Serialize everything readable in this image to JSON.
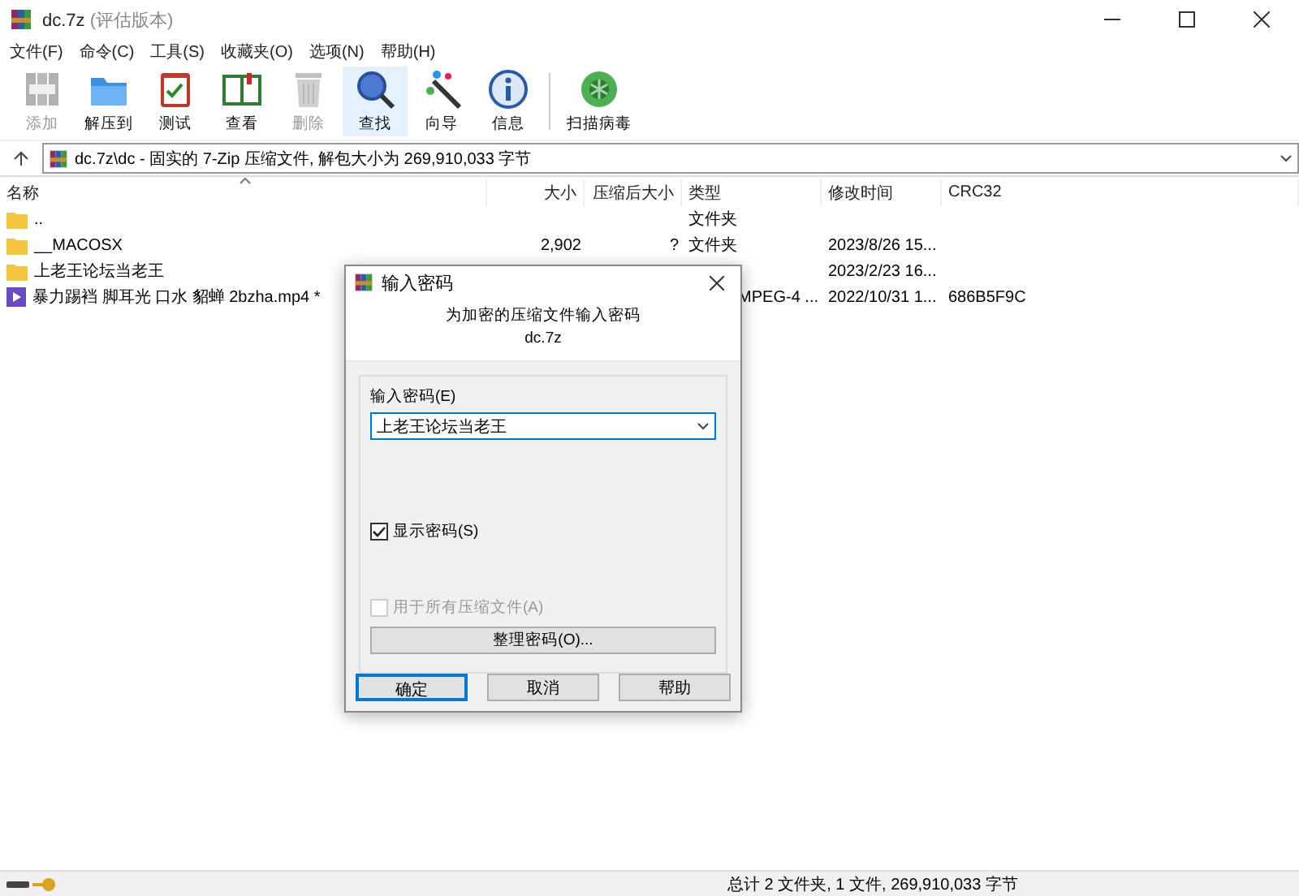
{
  "window": {
    "title": "dc.7z",
    "subtitle": "(评估版本)"
  },
  "menu": [
    "文件(F)",
    "命令(C)",
    "工具(S)",
    "收藏夹(O)",
    "选项(N)",
    "帮助(H)"
  ],
  "toolbar": [
    {
      "kind": "add",
      "label": "添加",
      "disabled": true,
      "highlighted": false
    },
    {
      "kind": "extract",
      "label": "解压到",
      "disabled": false,
      "highlighted": false
    },
    {
      "kind": "test",
      "label": "测试",
      "disabled": false,
      "highlighted": false
    },
    {
      "kind": "view",
      "label": "查看",
      "disabled": false,
      "highlighted": false
    },
    {
      "kind": "delete",
      "label": "删除",
      "disabled": true,
      "highlighted": false
    },
    {
      "kind": "find",
      "label": "查找",
      "disabled": false,
      "highlighted": true
    },
    {
      "kind": "wizard",
      "label": "向导",
      "disabled": false,
      "highlighted": false
    },
    {
      "kind": "info",
      "label": "信息",
      "disabled": false,
      "highlighted": false
    },
    {
      "kind": "scan",
      "label": "扫描病毒",
      "disabled": false,
      "highlighted": false
    }
  ],
  "address": "dc.7z\\dc - 固实的 7-Zip 压缩文件, 解包大小为 269,910,033 字节",
  "columns": [
    "名称",
    "大小",
    "压缩后大小",
    "类型",
    "修改时间",
    "CRC32"
  ],
  "rows": [
    {
      "kind": "folder",
      "name": "..",
      "type": "文件夹"
    },
    {
      "kind": "folder",
      "name": "__MACOSX",
      "size": "2,902",
      "packed": "?",
      "type": "文件夹",
      "modified": "2023/8/26 15..."
    },
    {
      "kind": "folder",
      "name": "上老王论坛当老王",
      "modified": "2023/2/23 16..."
    },
    {
      "kind": "file",
      "name": "暴力踢裆 脚耳光 口水 貂蝉  2bzha.mp4 *",
      "type": "MPEG-4 ...",
      "modified": "2022/10/31 1...",
      "crc": "686B5F9C"
    }
  ],
  "dialog": {
    "title": "输入密码",
    "heading": "为加密的压缩文件输入密码",
    "archive": "dc.7z",
    "field_label": "输入密码(E)",
    "password": "上老王论坛当老王",
    "show_password": {
      "label": "显示密码(S)",
      "checked": true,
      "disabled": false
    },
    "use_for_all": {
      "label": "用于所有压缩文件(A)",
      "checked": false,
      "disabled": true
    },
    "organize": "整理密码(O)...",
    "buttons": [
      {
        "label": "确定",
        "default": true
      },
      {
        "label": "取消",
        "default": false
      },
      {
        "label": "帮助",
        "default": false
      }
    ]
  },
  "status": "总计 2 文件夹, 1 文件, 269,910,033 字节"
}
